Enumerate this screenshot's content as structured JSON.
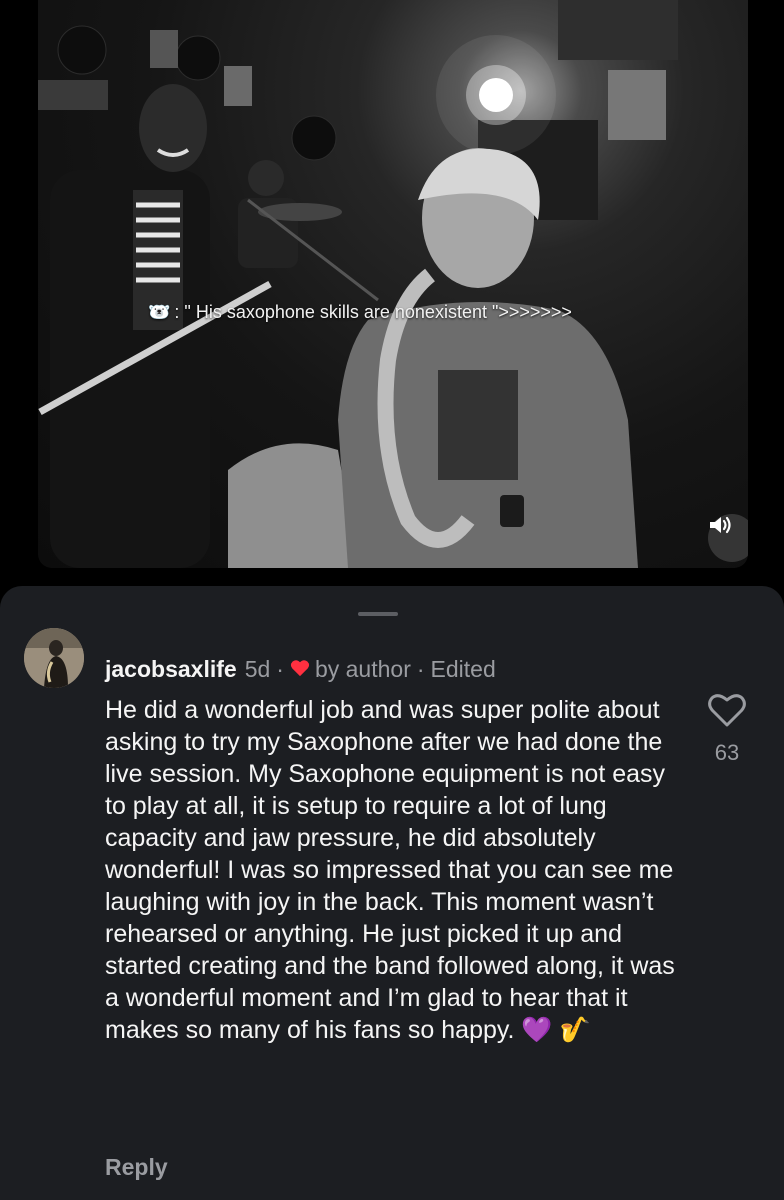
{
  "video": {
    "caption_emoji": "🐻‍❄️",
    "caption_text": ": \" His saxophone skills are nonexistent \">>>>>>>",
    "mute_icon": "speaker-icon"
  },
  "comment": {
    "username": "jacobsaxlife",
    "age": "5d",
    "separator1": "·",
    "liked_by": "by author",
    "separator2": "·",
    "edited": "Edited",
    "text": "He did a wonderful job and was super polite about asking to try my Saxophone after we had done the live session. My Saxophone equipment is not easy to play at all, it is setup to require a lot of lung capacity and jaw pressure, he did absolutely wonderful! I was so impressed that you can see me laughing with joy in the back. This moment wasn’t rehearsed or anything. He just picked it up and started creating and the band followed along, it was a wonderful moment and I’m glad to hear that it makes so many of his fans so happy.",
    "emoji_heart": "💜",
    "emoji_sax": "🎷",
    "like_count": "63",
    "reply_label": "Reply"
  },
  "colors": {
    "sheet_bg": "#1c1e22",
    "author_heart": "#ff3040",
    "muted_text": "#9a9ca1"
  }
}
